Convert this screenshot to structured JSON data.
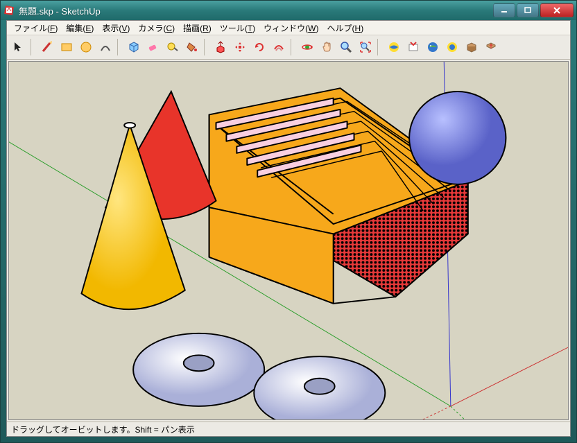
{
  "window": {
    "title": "無題.skp - SketchUp"
  },
  "menus": {
    "file": {
      "label": "ファイル",
      "accel": "F"
    },
    "edit": {
      "label": "編集",
      "accel": "E"
    },
    "view": {
      "label": "表示",
      "accel": "V"
    },
    "camera": {
      "label": "カメラ",
      "accel": "C"
    },
    "draw": {
      "label": "描画",
      "accel": "R"
    },
    "tools": {
      "label": "ツール",
      "accel": "T"
    },
    "win": {
      "label": "ウィンドウ",
      "accel": "W"
    },
    "help": {
      "label": "ヘルプ",
      "accel": "H"
    }
  },
  "toolbar_icons": {
    "select": "select-icon",
    "pencil": "pencil-icon",
    "rect": "rectangle-icon",
    "circle": "circle-icon",
    "arc": "arc-icon",
    "make": "make-component-icon",
    "eraser": "eraser-icon",
    "tape": "tape-measure-icon",
    "paint": "paint-bucket-icon",
    "push": "push-pull-icon",
    "move": "move-icon",
    "rotate": "rotate-icon",
    "offset": "offset-icon",
    "orbit": "orbit-icon",
    "pan": "pan-icon",
    "zoom": "zoom-icon",
    "zext": "zoom-extents-icon",
    "g1": "get-models-icon",
    "g2": "share-model-icon",
    "g3": "preview-icon",
    "g4": "warehouse-icon",
    "g5": "extensions-icon",
    "g6": "extension-warehouse-icon"
  },
  "status": {
    "text": "ドラッグしてオービットします。Shift = パン表示"
  }
}
